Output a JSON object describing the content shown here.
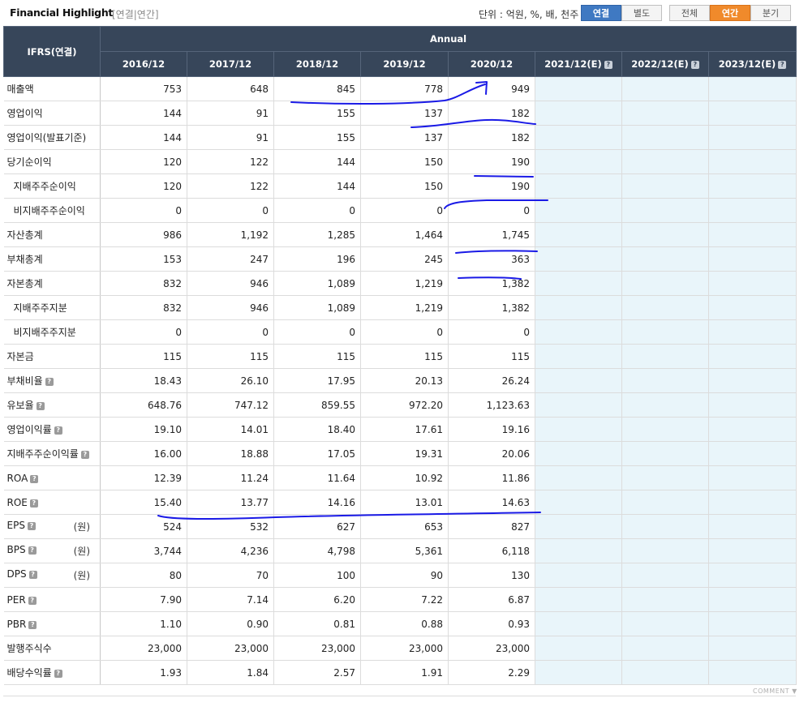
{
  "header": {
    "title": "Financial Highlight",
    "subtitle": "[연결|연간]",
    "unit_text": "단위 : 억원, %, 배, 천주",
    "consolidation_buttons": [
      "연결",
      "별도"
    ],
    "period_buttons": [
      "전체",
      "연간",
      "분기"
    ]
  },
  "table": {
    "corner_label": "IFRS(연결)",
    "group_label": "Annual",
    "columns": [
      "2016/12",
      "2017/12",
      "2018/12",
      "2019/12",
      "2020/12",
      "2021/12(E)",
      "2022/12(E)",
      "2023/12(E)"
    ],
    "rows": [
      {
        "label": "매출액",
        "values": [
          "753",
          "648",
          "845",
          "778",
          "949"
        ]
      },
      {
        "label": "영업이익",
        "values": [
          "144",
          "91",
          "155",
          "137",
          "182"
        ]
      },
      {
        "label": "영업이익(발표기준)",
        "values": [
          "144",
          "91",
          "155",
          "137",
          "182"
        ]
      },
      {
        "label": "당기순이익",
        "values": [
          "120",
          "122",
          "144",
          "150",
          "190"
        ]
      },
      {
        "label": "지배주주순이익",
        "values": [
          "120",
          "122",
          "144",
          "150",
          "190"
        ]
      },
      {
        "label": "비지배주주순이익",
        "values": [
          "0",
          "0",
          "0",
          "0",
          "0"
        ]
      },
      {
        "label": "자산총계",
        "values": [
          "986",
          "1,192",
          "1,285",
          "1,464",
          "1,745"
        ]
      },
      {
        "label": "부채총계",
        "values": [
          "153",
          "247",
          "196",
          "245",
          "363"
        ]
      },
      {
        "label": "자본총계",
        "values": [
          "832",
          "946",
          "1,089",
          "1,219",
          "1,382"
        ]
      },
      {
        "label": "지배주주지분",
        "values": [
          "832",
          "946",
          "1,089",
          "1,219",
          "1,382"
        ]
      },
      {
        "label": "비지배주주지분",
        "values": [
          "0",
          "0",
          "0",
          "0",
          "0"
        ]
      },
      {
        "label": "자본금",
        "values": [
          "115",
          "115",
          "115",
          "115",
          "115"
        ]
      },
      {
        "label": "부채비율",
        "values": [
          "18.43",
          "26.10",
          "17.95",
          "20.13",
          "26.24"
        ]
      },
      {
        "label": "유보율",
        "values": [
          "648.76",
          "747.12",
          "859.55",
          "972.20",
          "1,123.63"
        ]
      },
      {
        "label": "영업이익률",
        "values": [
          "19.10",
          "14.01",
          "18.40",
          "17.61",
          "19.16"
        ]
      },
      {
        "label": "지배주주순이익률",
        "values": [
          "16.00",
          "18.88",
          "17.05",
          "19.31",
          "20.06"
        ]
      },
      {
        "label": "ROA",
        "values": [
          "12.39",
          "11.24",
          "11.64",
          "10.92",
          "11.86"
        ]
      },
      {
        "label": "ROE",
        "values": [
          "15.40",
          "13.77",
          "14.16",
          "13.01",
          "14.63"
        ]
      },
      {
        "label": "EPS",
        "unit": "(원)",
        "values": [
          "524",
          "532",
          "627",
          "653",
          "827"
        ]
      },
      {
        "label": "BPS",
        "unit": "(원)",
        "values": [
          "3,744",
          "4,236",
          "4,798",
          "5,361",
          "6,118"
        ]
      },
      {
        "label": "DPS",
        "unit": "(원)",
        "values": [
          "80",
          "70",
          "100",
          "90",
          "130"
        ]
      },
      {
        "label": "PER",
        "values": [
          "7.90",
          "7.14",
          "6.20",
          "7.22",
          "6.87"
        ]
      },
      {
        "label": "PBR",
        "values": [
          "1.10",
          "0.90",
          "0.81",
          "0.88",
          "0.93"
        ]
      },
      {
        "label": "발행주식수",
        "values": [
          "23,000",
          "23,000",
          "23,000",
          "23,000",
          "23,000"
        ]
      },
      {
        "label": "배당수익률",
        "values": [
          "1.93",
          "1.84",
          "2.57",
          "1.91",
          "2.29"
        ]
      }
    ]
  },
  "footer": {
    "comment_label": "COMMENT"
  },
  "help_icon_glyph": "?",
  "help_icon_name": "question-icon",
  "colors": {
    "header_bg": "#37465a",
    "consolidated_active": "#3f79c2",
    "annual_active": "#f08a2b",
    "estimate_bg": "#e9f5fa",
    "annotation_pen": "#1a1ae6"
  }
}
